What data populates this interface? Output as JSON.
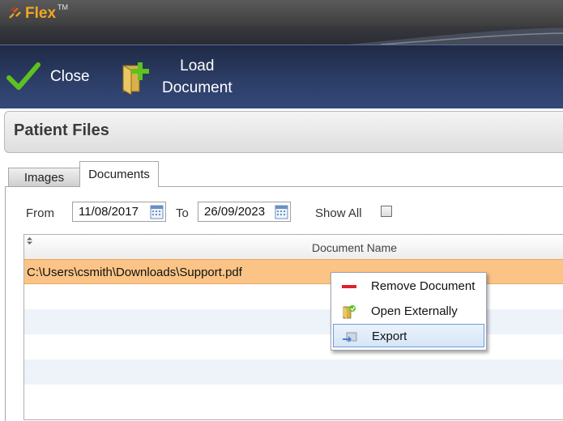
{
  "app": {
    "name": "Flex",
    "trademark": "TM"
  },
  "toolbar": {
    "close_label": "Close",
    "load_line1": "Load",
    "load_line2": "Document"
  },
  "header": {
    "title": "Patient Files"
  },
  "tabs": [
    {
      "label": "Images",
      "active": false
    },
    {
      "label": "Documents",
      "active": true
    }
  ],
  "filter": {
    "from_label": "From",
    "from_value": "11/08/2017",
    "to_label": "To",
    "to_value": "26/09/2023",
    "show_all_label": "Show All",
    "show_all_checked": false
  },
  "grid": {
    "columns": [
      "Document Name"
    ],
    "rows": [
      {
        "document_name": "C:\\Users\\csmith\\Downloads\\Support.pdf",
        "selected": true
      }
    ]
  },
  "context_menu": {
    "items": [
      {
        "label": "Remove Document",
        "icon": "remove-icon"
      },
      {
        "label": "Open Externally",
        "icon": "open-externally-icon"
      },
      {
        "label": "Export",
        "icon": "export-icon",
        "highlighted": true
      }
    ]
  },
  "colors": {
    "toolbar_bg": "#2c3d66",
    "logo_orange": "#f5a623",
    "selected_row": "#fbc486",
    "menu_highlight_border": "#6d9bd6"
  }
}
